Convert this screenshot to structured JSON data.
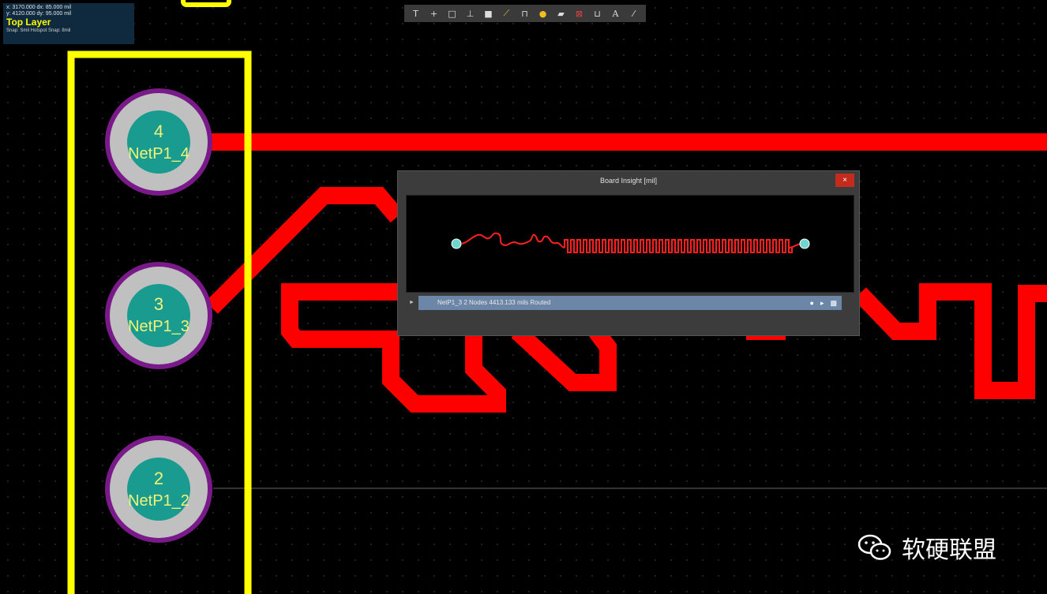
{
  "hud": {
    "x_line": "x: 3170.000  dx:  85.000 mil",
    "y_line": "y: 4120.000  dy:  95.000 mil",
    "layer": "Top Layer",
    "snap": "Snap: Smil Hotspot Snap: 8mil"
  },
  "toolbar": {
    "icons": [
      "filter-icon",
      "add-icon",
      "select-rect-icon",
      "align-icon",
      "place-pad-icon",
      "route-icon",
      "bus-icon",
      "via-icon",
      "fill-icon",
      "keepout-icon",
      "dimension-icon",
      "string-icon",
      "line-icon"
    ],
    "glyphs": [
      "T",
      "+",
      "□",
      "⊥",
      "■",
      "⟋",
      "⊓",
      "●",
      "▰",
      "⊠",
      "⊔",
      "A",
      "⁄"
    ]
  },
  "pads": [
    {
      "number": "4",
      "net": "NetP1_4"
    },
    {
      "number": "3",
      "net": "NetP1_3"
    },
    {
      "number": "2",
      "net": "NetP1_2"
    }
  ],
  "dialog": {
    "title": "Board Insight [mil]",
    "close": "×",
    "net_row": "NetP1_3   2 Nodes   4413.133 mils Routed",
    "row_arrow": "►"
  },
  "watermark": {
    "text": "软硬联盟"
  },
  "colors": {
    "track": "#ff0000",
    "overlay": "#ffff00",
    "pad_ring": "#7a1a8a",
    "pad_copper": "#c0c0c0",
    "pad_center": "#1a9b8f"
  }
}
